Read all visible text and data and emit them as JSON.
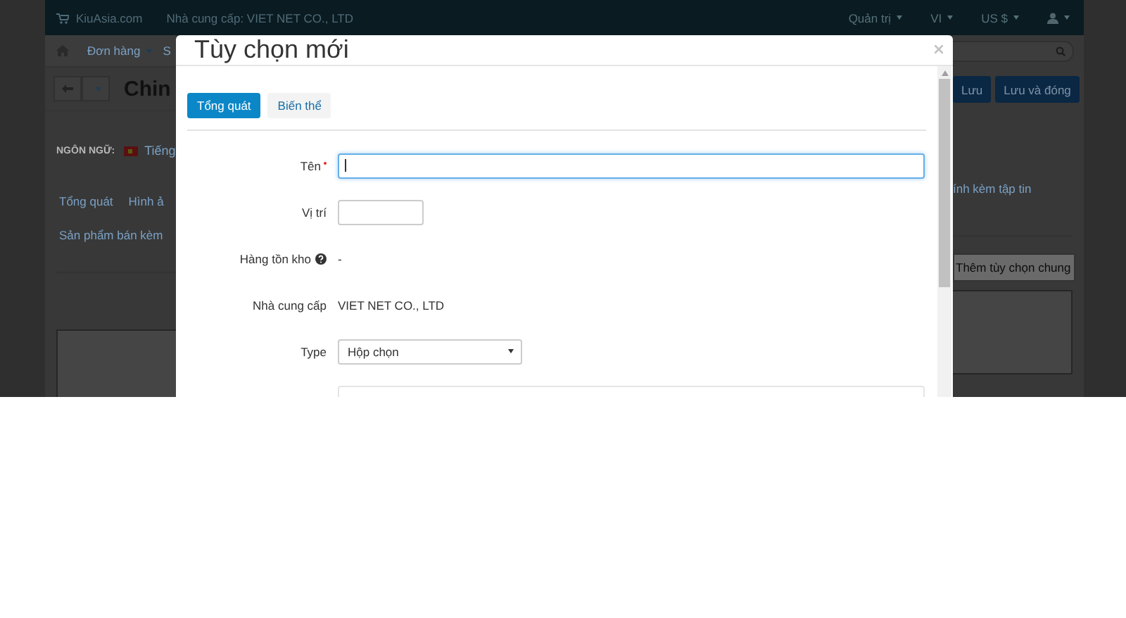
{
  "navbar": {
    "brand": "KiuAsia.com",
    "supplier": "Nhà cung cấp: VIET NET CO., LTD",
    "menus": [
      {
        "label": "Quản trị"
      },
      {
        "label": "VI"
      },
      {
        "label": "US $"
      }
    ]
  },
  "background": {
    "nav_items": [
      "Đơn hàng",
      "S"
    ],
    "title": "Chin",
    "language_label": "NGÔN NGỮ:",
    "language": "Tiếng",
    "tabs_row1": [
      "Tổng quát",
      "Hình ả"
    ],
    "tabs_row2": [
      "Sản phẩm bán kèm"
    ],
    "right_tab": "ính kèm tập tin",
    "buttons": [
      "Lưu",
      "Lưu và đóng"
    ],
    "add_button": "Thêm tùy chọn chung"
  },
  "modal": {
    "title": "Tùy chọn mới",
    "tabs": [
      {
        "label": "Tổng quát",
        "selected": true
      },
      {
        "label": "Biến thể",
        "selected": false
      }
    ],
    "fields": [
      {
        "kind": "longinput",
        "label": "Tên",
        "required": true,
        "focused": true,
        "help": false
      },
      {
        "kind": "shortinput",
        "label": "Vị trí",
        "required": false,
        "focused": false,
        "help": false
      },
      {
        "kind": "text",
        "label": "Hàng tồn kho",
        "required": false,
        "help": true,
        "value": "-"
      },
      {
        "kind": "text",
        "label": "Nhà cung cấp",
        "required": false,
        "help": false,
        "value": "VIET NET CO., LTD"
      },
      {
        "kind": "select",
        "label": "Type",
        "required": false,
        "help": false,
        "value": "Hộp chọn"
      }
    ]
  }
}
